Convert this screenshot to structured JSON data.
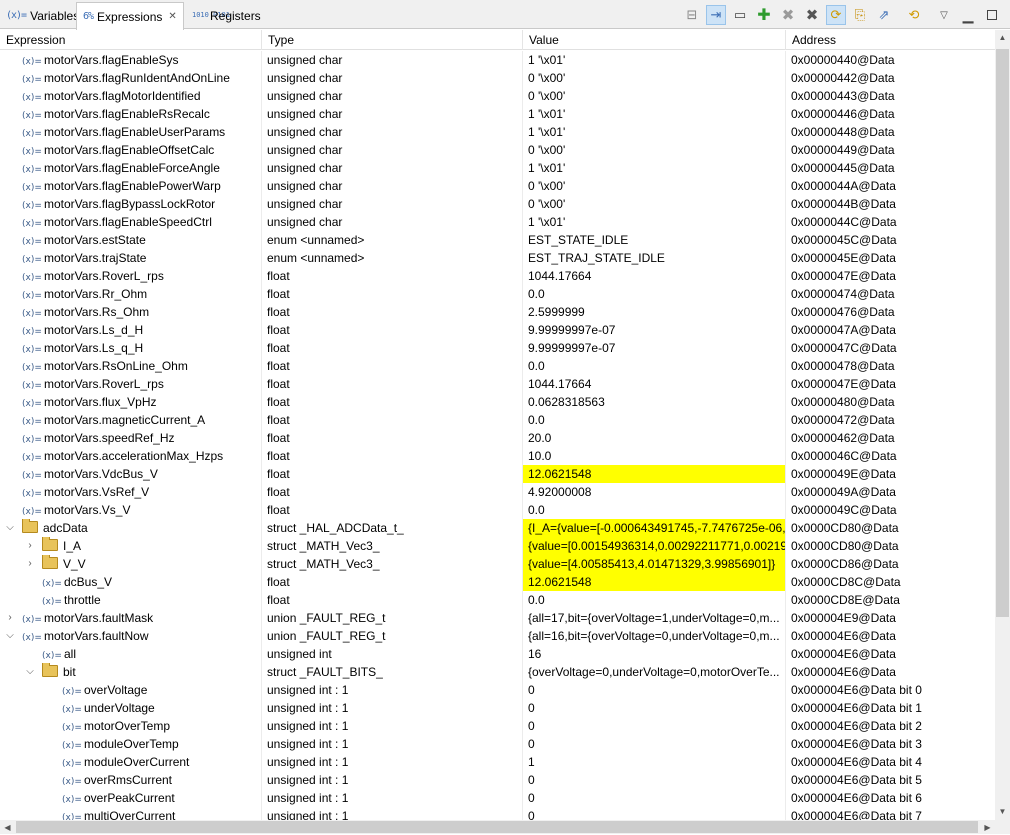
{
  "tabs": [
    {
      "label": "Variables",
      "icon": "(x)="
    },
    {
      "label": "Expressions",
      "icon": "6%"
    },
    {
      "label": "Registers",
      "icon": "1010 0101"
    }
  ],
  "columns": {
    "expression": "Expression",
    "type": "Type",
    "value": "Value",
    "address": "Address"
  },
  "rows": [
    {
      "name": "motorVars.flagEnableSys",
      "type": "unsigned char",
      "value": "1 '\\x01'",
      "address": "0x00000440@Data"
    },
    {
      "name": "motorVars.flagRunIdentAndOnLine",
      "type": "unsigned char",
      "value": "0 '\\x00'",
      "address": "0x00000442@Data"
    },
    {
      "name": "motorVars.flagMotorIdentified",
      "type": "unsigned char",
      "value": "0 '\\x00'",
      "address": "0x00000443@Data"
    },
    {
      "name": "motorVars.flagEnableRsRecalc",
      "type": "unsigned char",
      "value": "1 '\\x01'",
      "address": "0x00000446@Data"
    },
    {
      "name": "motorVars.flagEnableUserParams",
      "type": "unsigned char",
      "value": "1 '\\x01'",
      "address": "0x00000448@Data"
    },
    {
      "name": "motorVars.flagEnableOffsetCalc",
      "type": "unsigned char",
      "value": "0 '\\x00'",
      "address": "0x00000449@Data"
    },
    {
      "name": "motorVars.flagEnableForceAngle",
      "type": "unsigned char",
      "value": "1 '\\x01'",
      "address": "0x00000445@Data"
    },
    {
      "name": "motorVars.flagEnablePowerWarp",
      "type": "unsigned char",
      "value": "0 '\\x00'",
      "address": "0x0000044A@Data"
    },
    {
      "name": "motorVars.flagBypassLockRotor",
      "type": "unsigned char",
      "value": "0 '\\x00'",
      "address": "0x0000044B@Data"
    },
    {
      "name": "motorVars.flagEnableSpeedCtrl",
      "type": "unsigned char",
      "value": "1 '\\x01'",
      "address": "0x0000044C@Data"
    },
    {
      "name": "motorVars.estState",
      "type": "enum <unnamed>",
      "value": "EST_STATE_IDLE",
      "address": "0x0000045C@Data"
    },
    {
      "name": "motorVars.trajState",
      "type": "enum <unnamed>",
      "value": "EST_TRAJ_STATE_IDLE",
      "address": "0x0000045E@Data"
    },
    {
      "name": "motorVars.RoverL_rps",
      "type": "float",
      "value": "1044.17664",
      "address": "0x0000047E@Data"
    },
    {
      "name": "motorVars.Rr_Ohm",
      "type": "float",
      "value": "0.0",
      "address": "0x00000474@Data"
    },
    {
      "name": "motorVars.Rs_Ohm",
      "type": "float",
      "value": "2.5999999",
      "address": "0x00000476@Data"
    },
    {
      "name": "motorVars.Ls_d_H",
      "type": "float",
      "value": "9.99999997e-07",
      "address": "0x0000047A@Data"
    },
    {
      "name": "motorVars.Ls_q_H",
      "type": "float",
      "value": "9.99999997e-07",
      "address": "0x0000047C@Data"
    },
    {
      "name": "motorVars.RsOnLine_Ohm",
      "type": "float",
      "value": "0.0",
      "address": "0x00000478@Data"
    },
    {
      "name": "motorVars.RoverL_rps",
      "type": "float",
      "value": "1044.17664",
      "address": "0x0000047E@Data"
    },
    {
      "name": "motorVars.flux_VpHz",
      "type": "float",
      "value": "0.0628318563",
      "address": "0x00000480@Data"
    },
    {
      "name": "motorVars.magneticCurrent_A",
      "type": "float",
      "value": "0.0",
      "address": "0x00000472@Data"
    },
    {
      "name": "motorVars.speedRef_Hz",
      "type": "float",
      "value": "20.0",
      "address": "0x00000462@Data"
    },
    {
      "name": "motorVars.accelerationMax_Hzps",
      "type": "float",
      "value": "10.0",
      "address": "0x0000046C@Data"
    },
    {
      "name": "motorVars.VdcBus_V",
      "type": "float",
      "value": "12.0621548",
      "address": "0x0000049E@Data",
      "highlight": true
    },
    {
      "name": "motorVars.VsRef_V",
      "type": "float",
      "value": "4.92000008",
      "address": "0x0000049A@Data"
    },
    {
      "name": "motorVars.Vs_V",
      "type": "float",
      "value": "0.0",
      "address": "0x0000049C@Data"
    },
    {
      "name": "adcData",
      "type": "struct _HAL_ADCData_t_",
      "value": "{I_A={value=[-0.000643491745,-7.7476725e-06,...",
      "address": "0x0000CD80@Data",
      "highlight": true,
      "folder": true,
      "expander": "expanded"
    },
    {
      "name": "I_A",
      "type": "struct _MATH_Vec3_",
      "value": "{value=[0.00154936314,0.00292211771,0.002196...",
      "address": "0x0000CD80@Data",
      "highlight": true,
      "folder": true,
      "expander": "collapsed",
      "depth": 1
    },
    {
      "name": "V_V",
      "type": "struct _MATH_Vec3_",
      "value": "{value=[4.00585413,4.01471329,3.99856901]}",
      "address": "0x0000CD86@Data",
      "highlight": true,
      "folder": true,
      "expander": "collapsed",
      "depth": 1
    },
    {
      "name": "dcBus_V",
      "type": "float",
      "value": "12.0621548",
      "address": "0x0000CD8C@Data",
      "highlight": true,
      "depth": 1
    },
    {
      "name": "throttle",
      "type": "float",
      "value": "0.0",
      "address": "0x0000CD8E@Data",
      "depth": 1
    },
    {
      "name": "motorVars.faultMask",
      "type": "union _FAULT_REG_t",
      "value": "{all=17,bit={overVoltage=1,underVoltage=0,m...",
      "address": "0x000004E9@Data",
      "expander": "collapsed"
    },
    {
      "name": "motorVars.faultNow",
      "type": "union _FAULT_REG_t",
      "value": "{all=16,bit={overVoltage=0,underVoltage=0,m...",
      "address": "0x000004E6@Data",
      "expander": "expanded"
    },
    {
      "name": "all",
      "type": "unsigned int",
      "value": "16",
      "address": "0x000004E6@Data",
      "depth": 1
    },
    {
      "name": "bit",
      "type": "struct _FAULT_BITS_",
      "value": "{overVoltage=0,underVoltage=0,motorOverTe...",
      "address": "0x000004E6@Data",
      "folder": true,
      "expander": "expanded",
      "depth": 1
    },
    {
      "name": "overVoltage",
      "type": "unsigned int : 1",
      "value": "0",
      "address": "0x000004E6@Data bit 0",
      "depth": 2
    },
    {
      "name": "underVoltage",
      "type": "unsigned int : 1",
      "value": "0",
      "address": "0x000004E6@Data bit 1",
      "depth": 2
    },
    {
      "name": "motorOverTemp",
      "type": "unsigned int : 1",
      "value": "0",
      "address": "0x000004E6@Data bit 2",
      "depth": 2
    },
    {
      "name": "moduleOverTemp",
      "type": "unsigned int : 1",
      "value": "0",
      "address": "0x000004E6@Data bit 3",
      "depth": 2
    },
    {
      "name": "moduleOverCurrent",
      "type": "unsigned int : 1",
      "value": "1",
      "address": "0x000004E6@Data bit 4",
      "depth": 2
    },
    {
      "name": "overRmsCurrent",
      "type": "unsigned int : 1",
      "value": "0",
      "address": "0x000004E6@Data bit 5",
      "depth": 2
    },
    {
      "name": "overPeakCurrent",
      "type": "unsigned int : 1",
      "value": "0",
      "address": "0x000004E6@Data bit 6",
      "depth": 2
    },
    {
      "name": "multiOverCurrent",
      "type": "unsigned int : 1",
      "value": "0",
      "address": "0x000004E6@Data bit 7",
      "depth": 2
    }
  ],
  "var_icon": "(x)=",
  "highlight_color": "#ffff00",
  "toolbar_icons": [
    "collapse-all-icon",
    "toggle-layout-icon",
    "minimize-panel-icon",
    "add-expression-icon",
    "remove-expression-icon",
    "remove-all-icon",
    "refresh-icon",
    "new-window-icon",
    "export-icon",
    "continuous-refresh-icon",
    "view-menu-icon",
    "minimize-icon",
    "maximize-icon"
  ]
}
